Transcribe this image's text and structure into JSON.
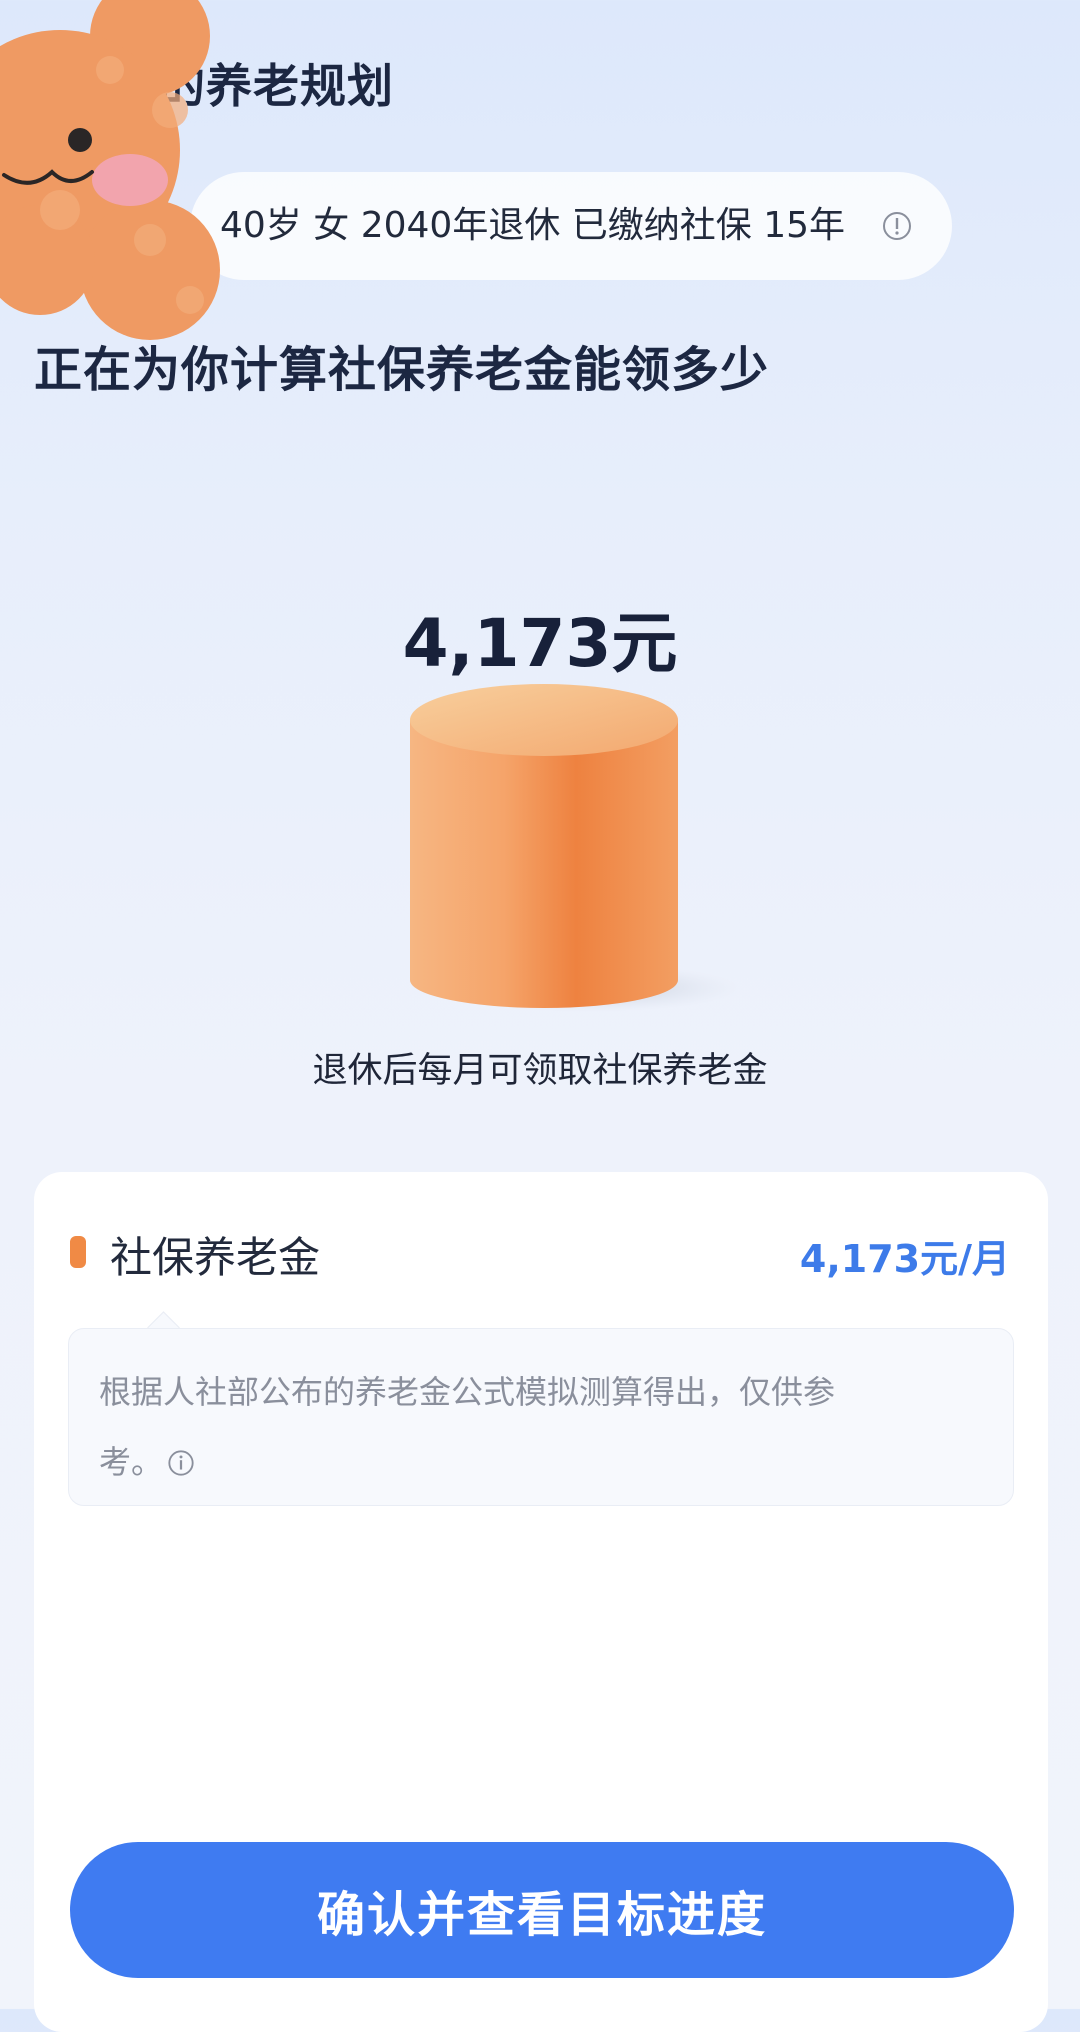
{
  "header": {
    "title": "我的养老规划"
  },
  "profile": {
    "summary": "40岁 女 2040年退休 已缴纳社保 15年"
  },
  "headline": "正在为你计算社保养老金能领多少",
  "result": {
    "amount": "4,173元",
    "caption": "退休后每月可领取社保养老金",
    "monthly_value": 4173
  },
  "card": {
    "label": "社保养老金",
    "value": "4,173元/月",
    "note_line1": "根据人社部公布的养老金公式模拟测算得出，仅供参",
    "note_line2": "考。"
  },
  "actions": {
    "confirm_label": "确认并查看目标进度"
  },
  "colors": {
    "accent_blue": "#3f7bf1",
    "value_blue": "#3d7be9",
    "cylinder_orange": "#f08a45",
    "title_dark": "#1c2742"
  },
  "icons": {
    "info": "info-circle-icon",
    "sticker": "teddy-bear-sticker"
  }
}
